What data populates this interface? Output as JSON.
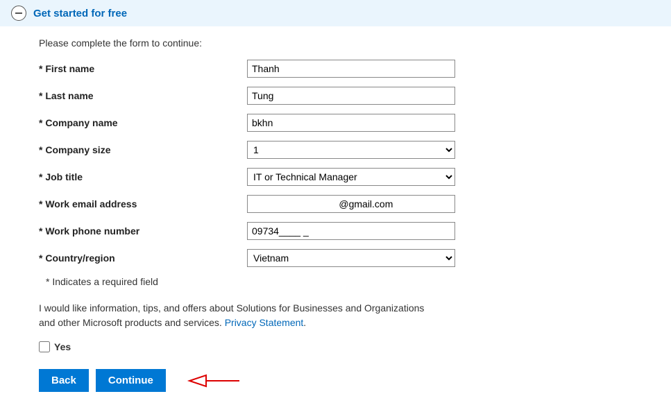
{
  "header": {
    "title": "Get started for free"
  },
  "form": {
    "instruction": "Please complete the form to continue:",
    "fields": {
      "first_name": {
        "label": "* First name",
        "value": "Thanh"
      },
      "last_name": {
        "label": "* Last name",
        "value": "Tung"
      },
      "company_name": {
        "label": "* Company name",
        "value": "bkhn"
      },
      "company_size": {
        "label": "* Company size",
        "value": "1"
      },
      "job_title": {
        "label": "* Job title",
        "value": "IT or Technical Manager"
      },
      "work_email": {
        "label": "* Work email address",
        "value": "           @gmail.com"
      },
      "work_phone": {
        "label": "* Work phone number",
        "value": "09734____ _"
      },
      "country": {
        "label": "* Country/region",
        "value": "Vietnam"
      }
    },
    "required_note": "* Indicates a required field",
    "consent_text": "I would like information, tips, and offers about Solutions for Businesses and Organizations and other Microsoft products and services. ",
    "privacy_link": "Privacy Statement",
    "consent_checkbox_label": "Yes",
    "buttons": {
      "back": "Back",
      "continue": "Continue"
    }
  }
}
